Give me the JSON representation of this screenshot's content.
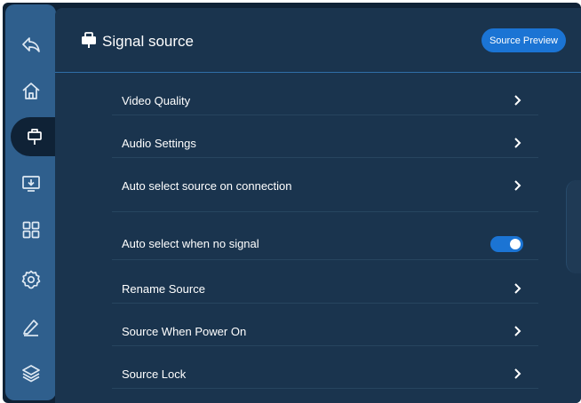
{
  "header": {
    "title": "Signal source",
    "preview_button": "Source Preview"
  },
  "sidebar": {
    "items": [
      {
        "icon": "back-icon"
      },
      {
        "icon": "home-icon"
      },
      {
        "icon": "signal-source-icon",
        "active": true
      },
      {
        "icon": "screen-download-icon"
      },
      {
        "icon": "apps-grid-icon"
      },
      {
        "icon": "settings-gear-icon"
      },
      {
        "icon": "pen-icon"
      },
      {
        "icon": "layers-icon"
      }
    ]
  },
  "settings": [
    {
      "label": "Video Quality",
      "control": "chevron"
    },
    {
      "label": "Audio Settings",
      "control": "chevron"
    },
    {
      "label": "Auto select source on connection",
      "control": "chevron"
    },
    {
      "label": "Auto select when no signal",
      "control": "toggle",
      "value": true
    },
    {
      "label": "Rename Source",
      "control": "chevron"
    },
    {
      "label": "Source When Power On",
      "control": "chevron"
    },
    {
      "label": "Source Lock",
      "control": "chevron"
    }
  ],
  "colors": {
    "accent": "#1b74d4",
    "sidebar": "#2f5f8d",
    "panel": "#1a344e",
    "background": "#0f2236"
  }
}
